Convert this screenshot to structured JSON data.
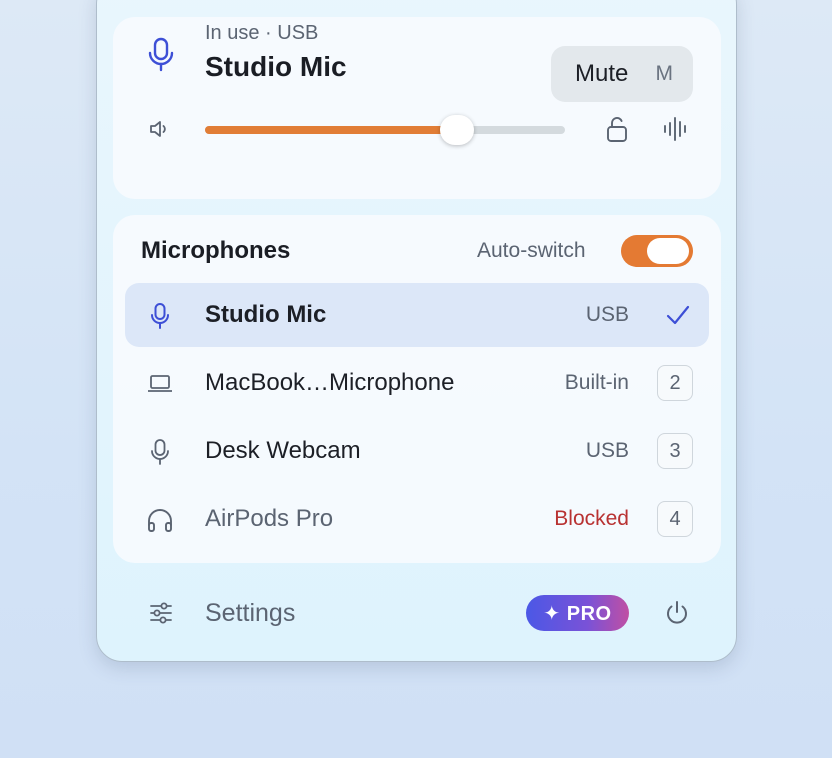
{
  "current": {
    "status": "In use · USB",
    "name": "Studio Mic",
    "mute_label": "Mute",
    "mute_shortcut": "M",
    "volume_percent": 70
  },
  "devices": {
    "title": "Microphones",
    "auto_switch_label": "Auto-switch",
    "auto_switch_on": true,
    "items": [
      {
        "name": "Studio Mic",
        "tag": "USB",
        "selected": true,
        "icon": "mic-icon"
      },
      {
        "name": "MacBook…Microphone",
        "tag": "Built-in",
        "key": "2",
        "icon": "laptop-icon"
      },
      {
        "name": "Desk Webcam",
        "tag": "USB",
        "key": "3",
        "icon": "mic-icon"
      },
      {
        "name": "AirPods Pro",
        "tag": "Blocked",
        "key": "4",
        "icon": "headphones-icon"
      }
    ]
  },
  "footer": {
    "settings_label": "Settings",
    "pro_label": "✦ PRO"
  },
  "colors": {
    "accent": "#e17d36",
    "selected_row": "#dce7f8",
    "blocked": "#b83232",
    "mic_icon": "#3d4fd6"
  }
}
